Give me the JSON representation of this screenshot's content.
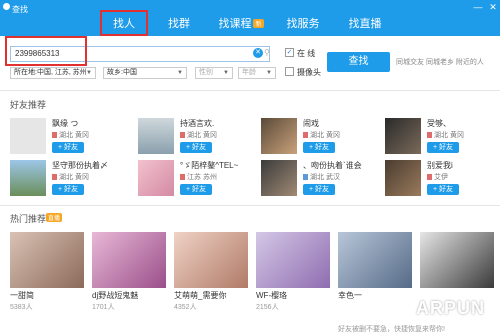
{
  "window": {
    "title": "查找",
    "controls": {
      "minimize": "—",
      "close": "✕"
    }
  },
  "tabs": [
    {
      "label": "找人",
      "active": true
    },
    {
      "label": "找群"
    },
    {
      "label": "找课程",
      "badge": "新"
    },
    {
      "label": "找服务"
    },
    {
      "label": "找直播"
    }
  ],
  "search": {
    "value": "2399865313",
    "online_label": "在 线",
    "online_checked": true,
    "camera_label": "摄像头",
    "camera_checked": false,
    "find_button": "查找",
    "quick_links": "同城交友  同城老乡  附近的人"
  },
  "filters": {
    "location": "所在地:中国, 江苏, 苏州",
    "hometown": "故乡:中国",
    "gender": "性别",
    "age": "年龄"
  },
  "friends_section": {
    "title": "好友推荐",
    "add_label": "+ 好友",
    "items": [
      {
        "name": "飘缘  つ",
        "location": "湖北 黄冈",
        "gender": "male"
      },
      {
        "name": "持酒言欢.",
        "location": "湖北 黄冈",
        "gender": "male"
      },
      {
        "name": "闹戏",
        "location": "湖北 黄冈",
        "gender": "male"
      },
      {
        "name": "受够、",
        "location": "湖北 黄冈",
        "gender": "male"
      },
      {
        "name": "坚守那份执着〆",
        "location": "湖北 黄冈",
        "gender": "male"
      },
      {
        "name": "°ゞ陌梓鏊^TEL~",
        "location": "江苏 苏州",
        "gender": "male"
      },
      {
        "name": "、吻份执着`谁会",
        "location": "湖北 武汉",
        "gender": "female"
      },
      {
        "name": "别爱我i",
        "location": "艾伊",
        "gender": "male"
      }
    ]
  },
  "hot_section": {
    "title": "热门推荐",
    "badge": "直播",
    "items": [
      {
        "name": "一甜简",
        "count": "5383人"
      },
      {
        "name": "dj野战短鬼魅",
        "count": "1701人"
      },
      {
        "name": "艾萌萌_需要你",
        "count": "4352人"
      },
      {
        "name": "WF-樱珞",
        "count": "2156人"
      },
      {
        "name": "幸色一",
        "count": ""
      },
      {
        "name": "",
        "count": ""
      }
    ]
  },
  "footer": "好友被删不要急，快捷恢复来帮你!",
  "watermark": "ARPUN",
  "colors": {
    "titlebar": "#1e9be9",
    "highlight": "#e03030",
    "accent": "#1e9be9",
    "badge": "#f5a623"
  }
}
